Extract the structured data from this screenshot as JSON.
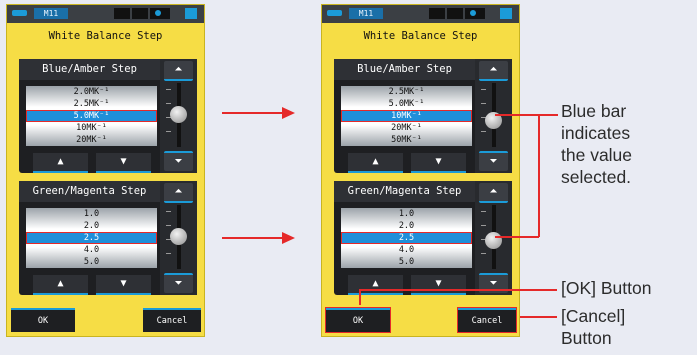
{
  "screens": [
    {
      "status_mode": "M11",
      "title": "White Balance Step",
      "blue_panel": {
        "title": "Blue/Amber Step",
        "items": [
          "2.0MK⁻¹",
          "2.5MK⁻¹",
          "5.0MK⁻¹",
          "10MK⁻¹",
          "20MK⁻¹"
        ],
        "selected_index": 2,
        "slider_position": 0.5
      },
      "green_panel": {
        "title": "Green/Magenta Step",
        "items": [
          "1.0",
          "2.0",
          "2.5",
          "4.0",
          "5.0"
        ],
        "selected_index": 2,
        "slider_position": 0.5
      },
      "ok_label": "OK",
      "cancel_label": "Cancel"
    },
    {
      "status_mode": "M11",
      "title": "White Balance Step",
      "blue_panel": {
        "title": "Blue/Amber Step",
        "items": [
          "2.5MK⁻¹",
          "5.0MK⁻¹",
          "10MK⁻¹",
          "20MK⁻¹",
          "50MK⁻¹"
        ],
        "selected_index": 2,
        "slider_position": 0.5
      },
      "green_panel": {
        "title": "Green/Magenta Step",
        "items": [
          "1.0",
          "2.0",
          "2.5",
          "4.0",
          "5.0"
        ],
        "selected_index": 2,
        "slider_position": 0.5
      },
      "ok_label": "OK",
      "cancel_label": "Cancel"
    }
  ],
  "controls": {
    "scroll_top_glyph": "⏶",
    "scroll_bottom_glyph": "⏷",
    "up_glyph": "▲",
    "down_glyph": "▼"
  },
  "annotations": {
    "blue_bar_note": [
      "Blue bar",
      "indicates",
      "the value",
      "selected."
    ],
    "ok_note": "[OK] Button",
    "cancel_note": [
      "[Cancel]",
      "Button"
    ]
  },
  "colors": {
    "screen_bg": "#f6dd45",
    "accent_blue": "#1f8fd9",
    "highlight_red": "#e52929",
    "panel_dark": "#1e1f22"
  }
}
